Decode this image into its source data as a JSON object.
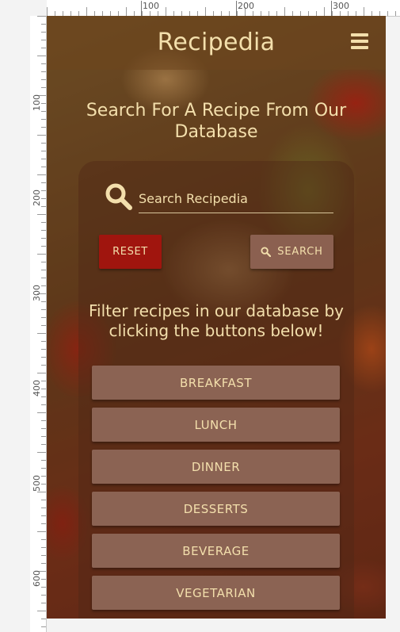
{
  "ruler": {
    "top_labels": [
      "100",
      "200",
      "300"
    ],
    "left_labels": [
      "100",
      "200",
      "300",
      "400",
      "500",
      "600"
    ]
  },
  "navbar": {
    "brand": "Recipedia",
    "menu_icon": "hamburger-menu-icon"
  },
  "search": {
    "heading": "Search For A Recipe From Our Database",
    "placeholder": "Search Recipedia",
    "icon": "magnifier-icon",
    "reset_label": "RESET",
    "search_label": "SEARCH"
  },
  "filters": {
    "heading": "Filter recipes in our database by clicking the buttons below!",
    "items": [
      "BREAKFAST",
      "LUNCH",
      "DINNER",
      "DESSERTS",
      "BEVERAGE",
      "VEGETARIAN"
    ]
  },
  "colors": {
    "text": "#f3dfac",
    "reset": "#a0150e",
    "button": "#8b6353"
  }
}
